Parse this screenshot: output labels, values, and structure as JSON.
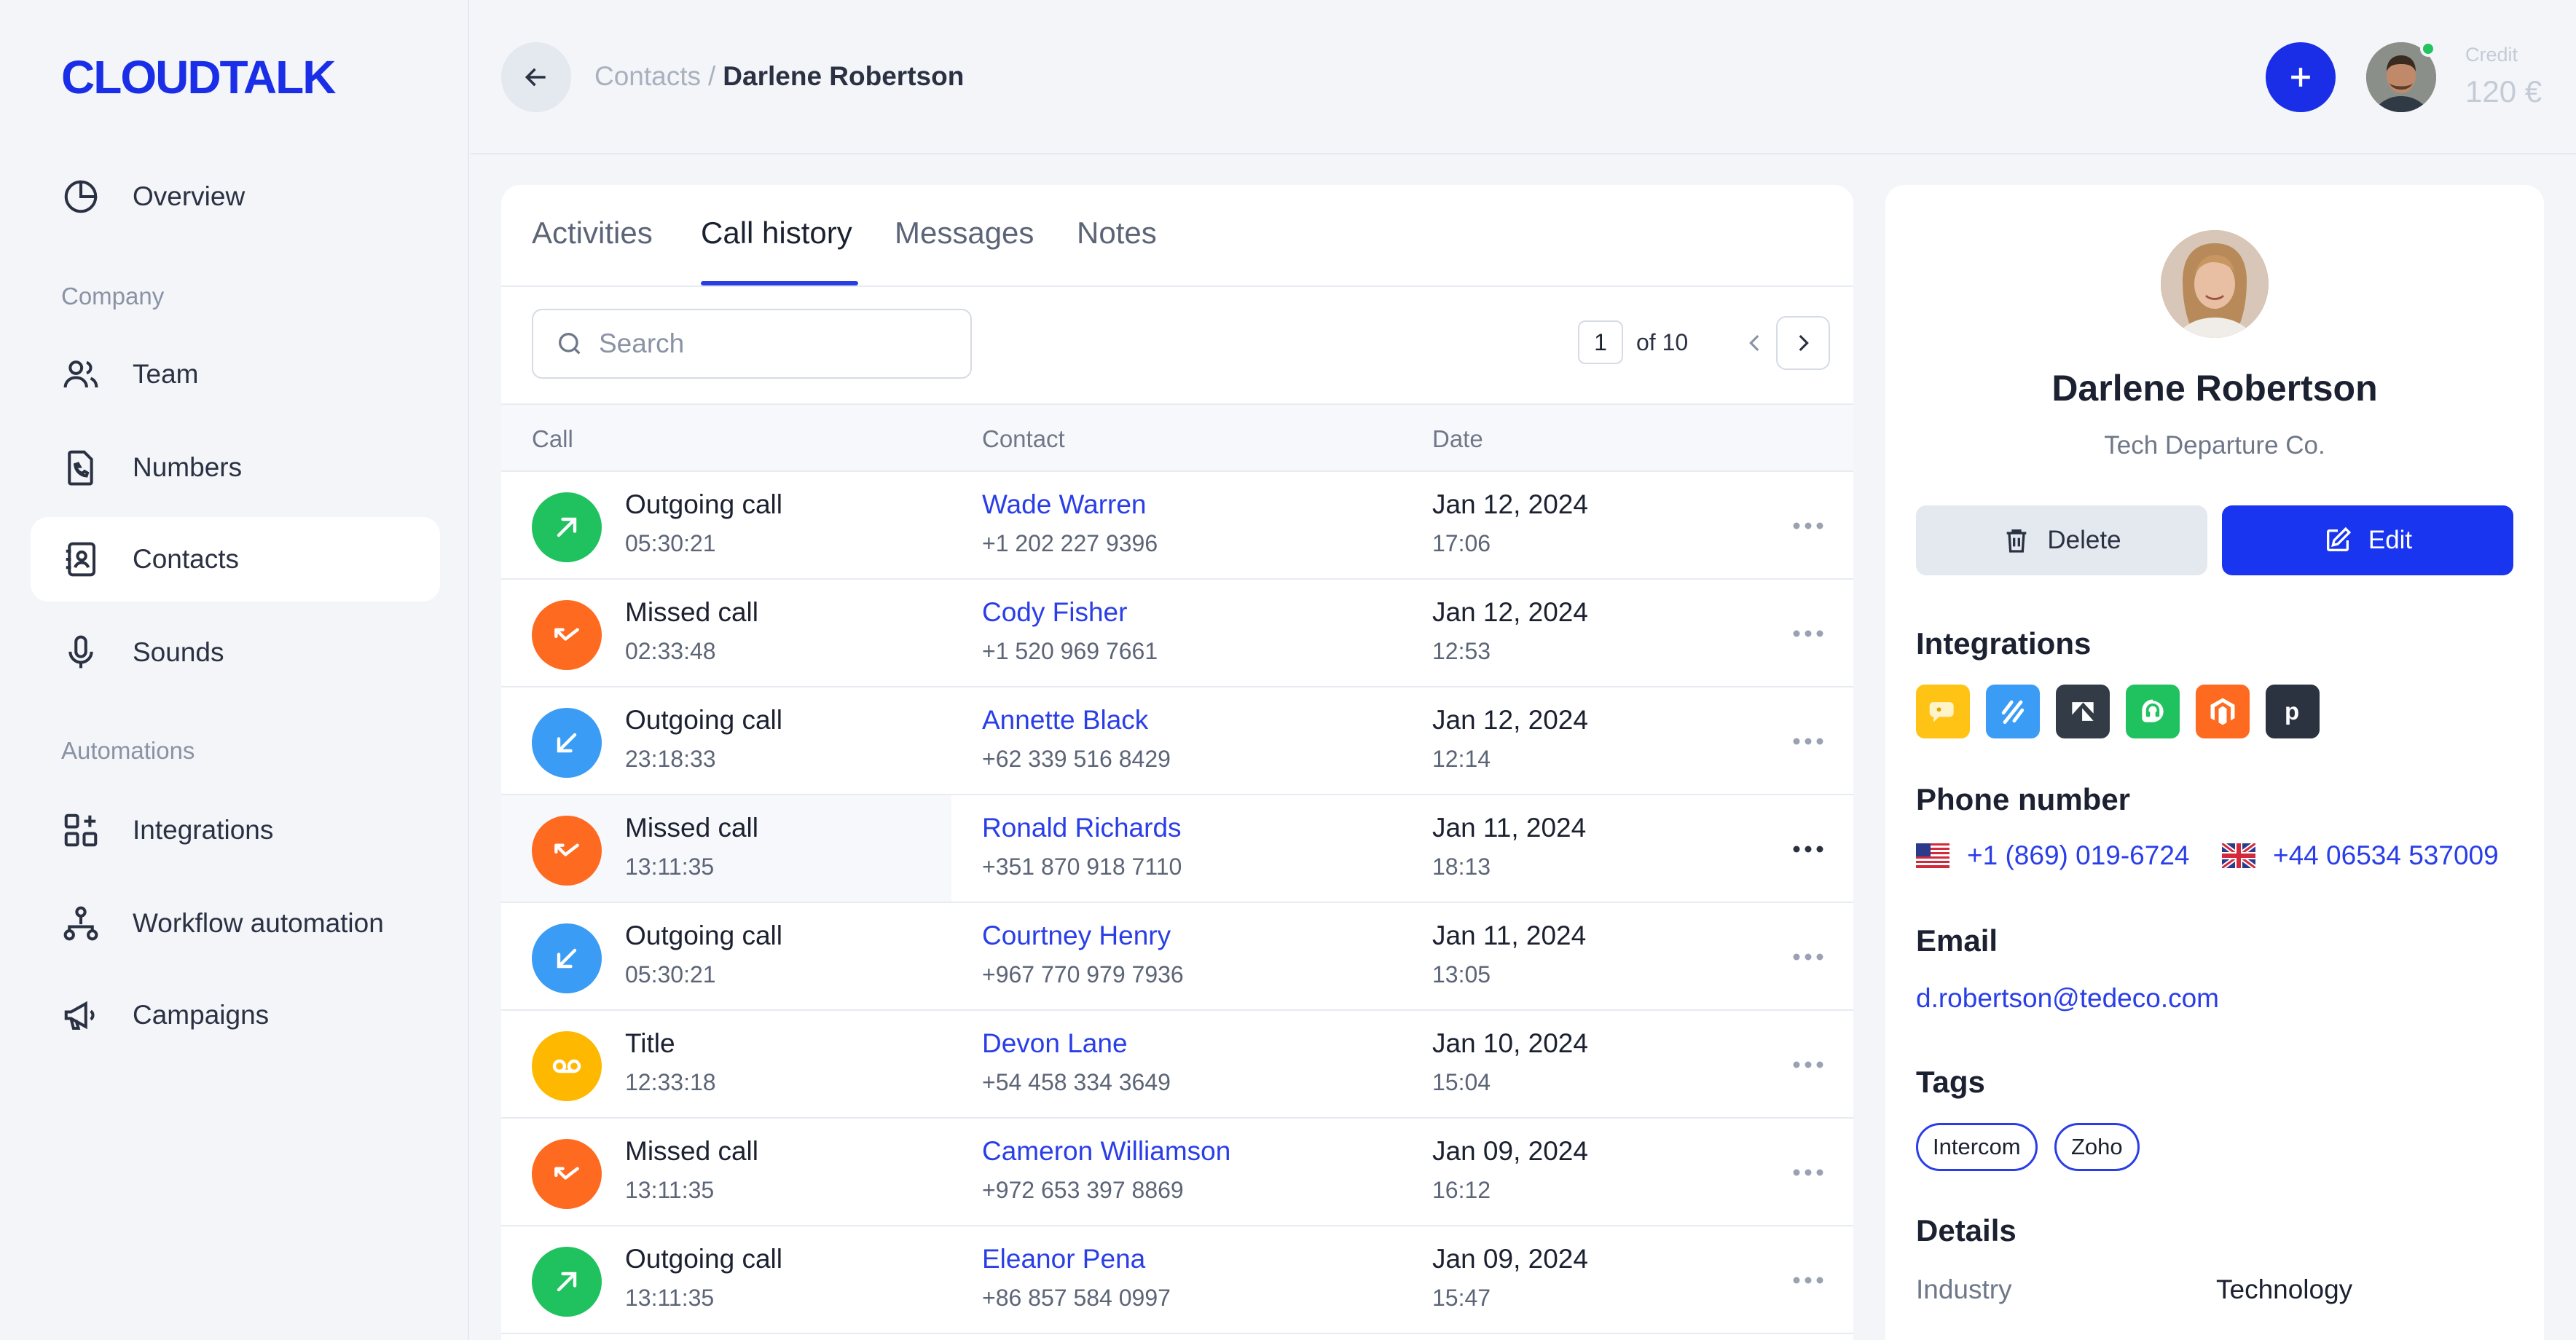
{
  "app": {
    "logo_text": "CLOUDTALK",
    "brand_color": "#1a2ee8"
  },
  "sidebar": {
    "items": [
      {
        "label": "Overview",
        "icon": "pie-chart-icon"
      },
      {
        "label": "Team",
        "icon": "users-icon"
      },
      {
        "label": "Numbers",
        "icon": "phone-file-icon"
      },
      {
        "label": "Contacts",
        "icon": "contact-book-icon",
        "active": true
      },
      {
        "label": "Sounds",
        "icon": "microphone-icon"
      },
      {
        "label": "Integrations",
        "icon": "apps-add-icon"
      },
      {
        "label": "Workflow automation",
        "icon": "workflow-icon"
      },
      {
        "label": "Campaigns",
        "icon": "megaphone-icon"
      }
    ],
    "sections": [
      "Company",
      "Automations"
    ]
  },
  "header": {
    "breadcrumb_parent": "Contacts",
    "breadcrumb_sep": "/",
    "breadcrumb_current": "Darlene Robertson",
    "credit_label": "Credit",
    "credit_value": "120 €"
  },
  "tabs": [
    "Activities",
    "Call history",
    "Messages",
    "Notes"
  ],
  "active_tab": "Call history",
  "search": {
    "placeholder": "Search",
    "value": ""
  },
  "pager": {
    "page": "1",
    "of_label": "of 10"
  },
  "table": {
    "columns": [
      "Call",
      "Contact",
      "Date"
    ],
    "rows": [
      {
        "type": "Outgoing call",
        "duration": "05:30:21",
        "name": "Wade Warren",
        "phone": "+1 202 227 9396",
        "date": "Jan 12, 2024",
        "time": "17:06",
        "kind": "outgoing-green"
      },
      {
        "type": "Missed call",
        "duration": "02:33:48",
        "name": "Cody Fisher",
        "phone": "+1 520 969 7661",
        "date": "Jan 12, 2024",
        "time": "12:53",
        "kind": "missed"
      },
      {
        "type": "Outgoing call",
        "duration": "23:18:33",
        "name": "Annette Black",
        "phone": "+62 339 516 8429",
        "date": "Jan 12, 2024",
        "time": "12:14",
        "kind": "incoming-blue"
      },
      {
        "type": "Missed call",
        "duration": "13:11:35",
        "name": "Ronald Richards",
        "phone": "+351 870 918 7110",
        "date": "Jan 11, 2024",
        "time": "18:13",
        "kind": "missed"
      },
      {
        "type": "Outgoing call",
        "duration": "05:30:21",
        "name": "Courtney Henry",
        "phone": "+967 770 979 7936",
        "date": "Jan 11, 2024",
        "time": "13:05",
        "kind": "incoming-blue"
      },
      {
        "type": "Title",
        "duration": "12:33:18",
        "name": "Devon Lane",
        "phone": "+54 458 334 3649",
        "date": "Jan 10, 2024",
        "time": "15:04",
        "kind": "voicemail"
      },
      {
        "type": "Missed call",
        "duration": "13:11:35",
        "name": "Cameron Williamson",
        "phone": "+972 653 397 8869",
        "date": "Jan 09, 2024",
        "time": "16:12",
        "kind": "missed"
      },
      {
        "type": "Outgoing call",
        "duration": "13:11:35",
        "name": "Eleanor Pena",
        "phone": "+86 857 584 0997",
        "date": "Jan 09, 2024",
        "time": "15:47",
        "kind": "outgoing-green"
      }
    ]
  },
  "profile": {
    "name": "Darlene Robertson",
    "company": "Tech Departure Co.",
    "delete_label": "Delete",
    "edit_label": "Edit",
    "integrations_title": "Integrations",
    "integrations": [
      "chat-bubble-icon",
      "hubspot-slash-icon",
      "zendesk-icon",
      "freshdesk-icon",
      "magento-icon",
      "pipedrive-icon"
    ],
    "phone_title": "Phone number",
    "phones": [
      {
        "flag": "us-flag-icon",
        "number": "+1 (869) 019-6724"
      },
      {
        "flag": "uk-flag-icon",
        "number": "+44 06534 537009"
      }
    ],
    "email_title": "Email",
    "email": "d.robertson@tedeco.com",
    "tags_title": "Tags",
    "tags": [
      "Intercom",
      "Zoho"
    ],
    "details_title": "Details",
    "details": [
      {
        "label": "Industry",
        "value": "Technology"
      }
    ]
  },
  "colors": {
    "green": "#1fc25e",
    "orange": "#ff6a21",
    "blue": "#3a9cf5",
    "yellow": "#ffb800",
    "link": "#2a3ee8"
  }
}
